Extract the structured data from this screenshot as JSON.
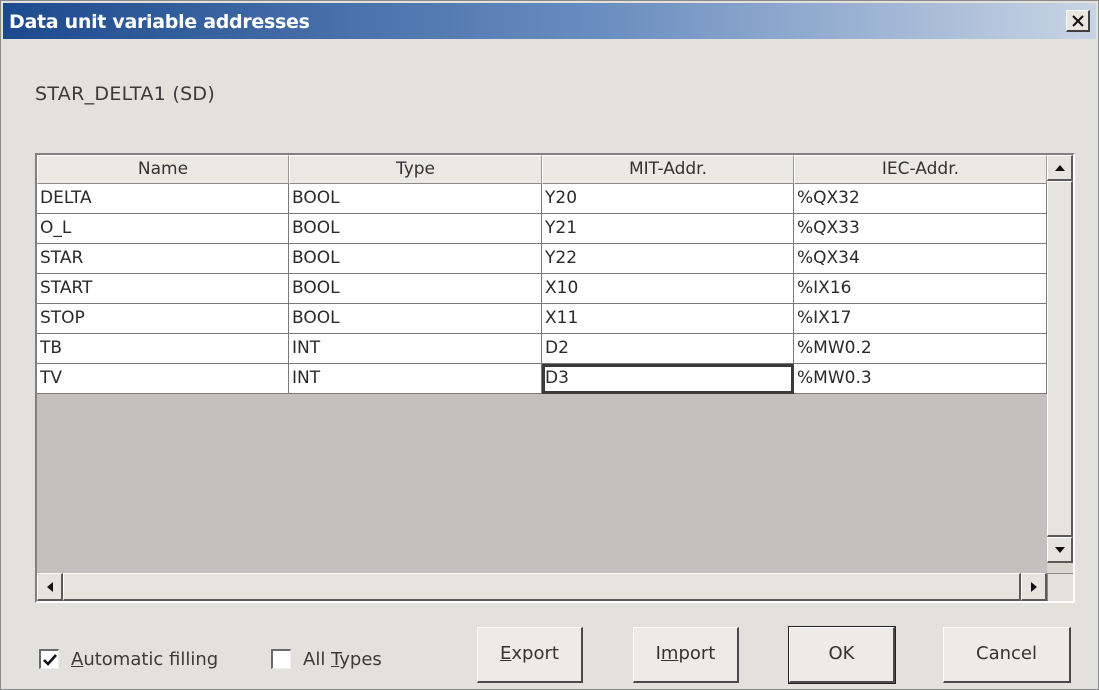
{
  "window": {
    "title": "Data unit variable addresses",
    "close_icon": "close-icon"
  },
  "unit_label": "STAR_DELTA1 (SD)",
  "table": {
    "columns": [
      "Name",
      "Type",
      "MIT-Addr.",
      "IEC-Addr."
    ],
    "rows": [
      [
        "DELTA",
        "BOOL",
        "Y20",
        "%QX32"
      ],
      [
        "O_L",
        "BOOL",
        "Y21",
        "%QX33"
      ],
      [
        "STAR",
        "BOOL",
        "Y22",
        "%QX34"
      ],
      [
        "START",
        "BOOL",
        "X10",
        "%IX16"
      ],
      [
        "STOP",
        "BOOL",
        "X11",
        "%IX17"
      ],
      [
        "TB",
        "INT",
        "D2",
        "%MW0.2"
      ],
      [
        "TV",
        "INT",
        "D3",
        "%MW0.3"
      ]
    ],
    "selected_cell": {
      "row": 6,
      "column": 2
    }
  },
  "options": {
    "automatic_filling": {
      "label_first": "A",
      "label_rest": "utomatic filling",
      "checked": true
    },
    "all_types": {
      "label_prefix": "All ",
      "label_underlined": "T",
      "label_rest": "ypes",
      "checked": false
    }
  },
  "buttons": {
    "export": {
      "underlined": "E",
      "rest": "xport"
    },
    "import": {
      "prefix": "I",
      "underlined": "m",
      "rest": "port"
    },
    "ok": "OK",
    "cancel": "Cancel"
  }
}
